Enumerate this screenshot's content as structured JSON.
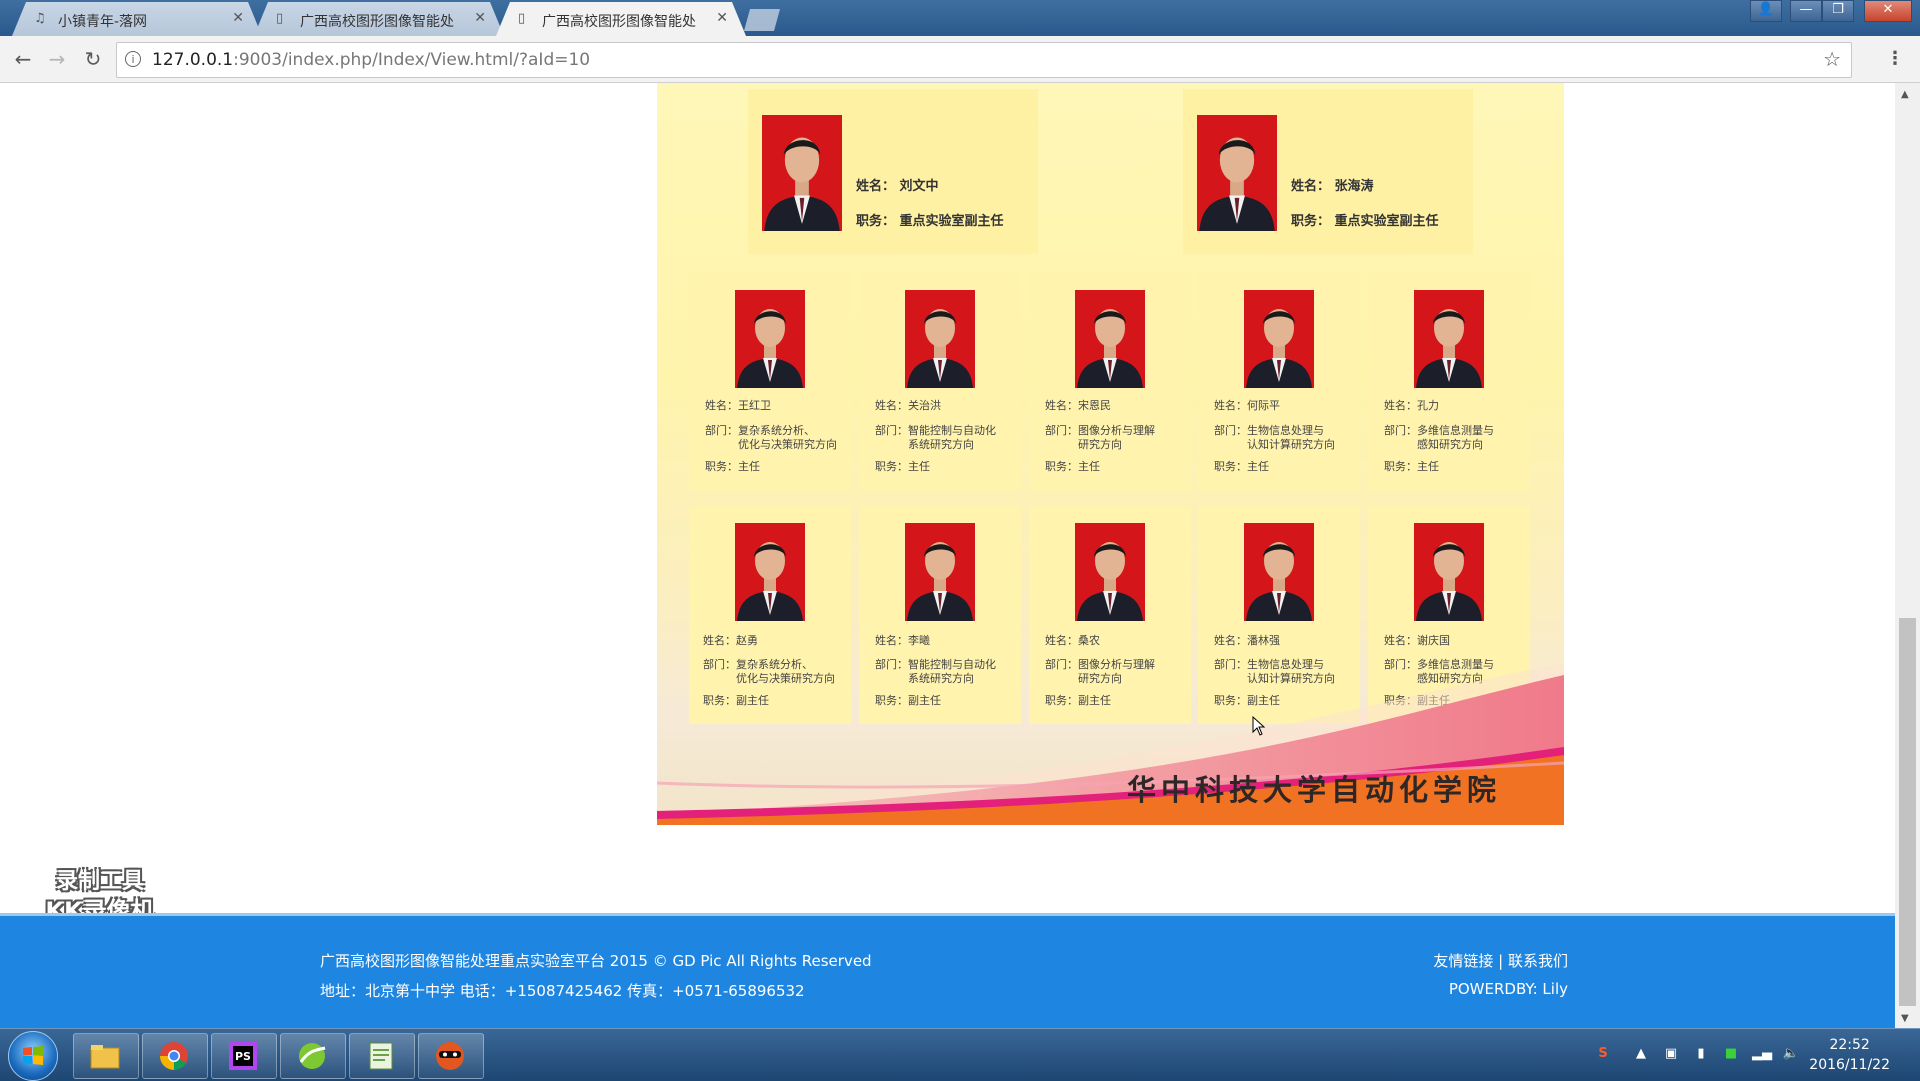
{
  "browser": {
    "tabs": [
      {
        "title": "小镇青年-落网",
        "active": false
      },
      {
        "title": "广西高校图形图像智能处",
        "active": false
      },
      {
        "title": "广西高校图形图像智能处",
        "active": true
      }
    ],
    "url_host": "127.0.0.1",
    "url_rest": ":9003/index.php/Index/View.html/?aId=10"
  },
  "poster": {
    "leaders": [
      {
        "name_line": "姓名：  刘文中",
        "role_line": "职务：  重点实验室副主任"
      },
      {
        "name_line": "姓名：  张海涛",
        "role_line": "职务：  重点实验室副主任"
      }
    ],
    "row1": [
      {
        "name": "姓名：王红卫",
        "dept1": "部门：复杂系统分析、",
        "dept2": "优化与决策研究方向",
        "role": "职务：主任"
      },
      {
        "name": "姓名：关治洪",
        "dept1": "部门：智能控制与自动化",
        "dept2": "系统研究方向",
        "role": "职务：主任"
      },
      {
        "name": "姓名：宋恩民",
        "dept1": "部门：图像分析与理解",
        "dept2": "研究方向",
        "role": "职务：主任"
      },
      {
        "name": "姓名：何际平",
        "dept1": "部门：生物信息处理与",
        "dept2": "认知计算研究方向",
        "role": "职务：主任"
      },
      {
        "name": "姓名：孔力",
        "dept1": "部门：多维信息测量与",
        "dept2": "感知研究方向",
        "role": "职务：主任"
      }
    ],
    "row2": [
      {
        "name": "姓名：赵勇",
        "dept1": "部门：复杂系统分析、",
        "dept2": "优化与决策研究方向",
        "role": "职务：副主任"
      },
      {
        "name": "姓名：李曦",
        "dept1": "部门：智能控制与自动化",
        "dept2": "系统研究方向",
        "role": "职务：副主任"
      },
      {
        "name": "姓名：桑农",
        "dept1": "部门：图像分析与理解",
        "dept2": "研究方向",
        "role": "职务：副主任"
      },
      {
        "name": "姓名：潘林强",
        "dept1": "部门：生物信息处理与",
        "dept2": "认知计算研究方向",
        "role": "职务：副主任"
      },
      {
        "name": "姓名：谢庆国",
        "dept1": "部门：多维信息测量与",
        "dept2": "感知研究方向",
        "role": "职务：副主任"
      }
    ],
    "college": "华中科技大学自动化学院"
  },
  "watermark": {
    "line1": "录制工具",
    "line2": "KK录像机"
  },
  "footer": {
    "copyright": "广西高校图形图像智能处理重点实验室平台 2015 © GD Pic All Rights Reserved",
    "address": "地址：北京第十中学 电话：+15087425462 传真：+0571-65896532",
    "links": "友情链接 |  联系我们",
    "powered": "POWERDBY: Lily"
  },
  "taskbar": {
    "apps": [
      "file-explorer-icon",
      "chrome-icon",
      "phpstorm-icon",
      "green-app-icon",
      "notepad-icon",
      "kk-recorder-icon"
    ],
    "time": "22:52",
    "date": "2016/11/22"
  },
  "colors": {
    "footer": "#1e86e0",
    "portrait_bg": "#d4161b",
    "poster_bg": "#fff4ac"
  }
}
